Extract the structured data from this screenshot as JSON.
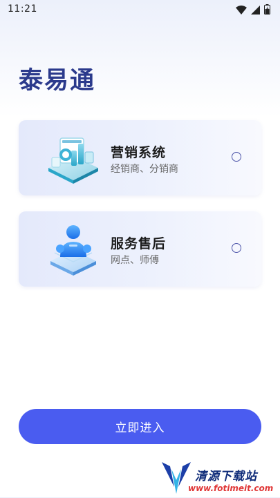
{
  "status_bar": {
    "time": "11:21",
    "icons": [
      "wifi-icon",
      "signal-icon",
      "battery-icon"
    ]
  },
  "app": {
    "title": "泰易通"
  },
  "options": [
    {
      "id": "marketing",
      "title": "营销系统",
      "subtitle": "经销商、分销商",
      "icon": "data-dashboard-illustration",
      "selected": false
    },
    {
      "id": "service",
      "title": "服务售后",
      "subtitle": "网点、师傅",
      "icon": "service-person-illustration",
      "selected": false
    }
  ],
  "enter_button": {
    "label": "立即进入"
  },
  "watermark": {
    "title": "清源下载站",
    "url": "www.fotimeit.com"
  },
  "colors": {
    "primary": "#4a5cf0",
    "title": "#2b3a8c",
    "card_bg": "#e8ecfb"
  }
}
